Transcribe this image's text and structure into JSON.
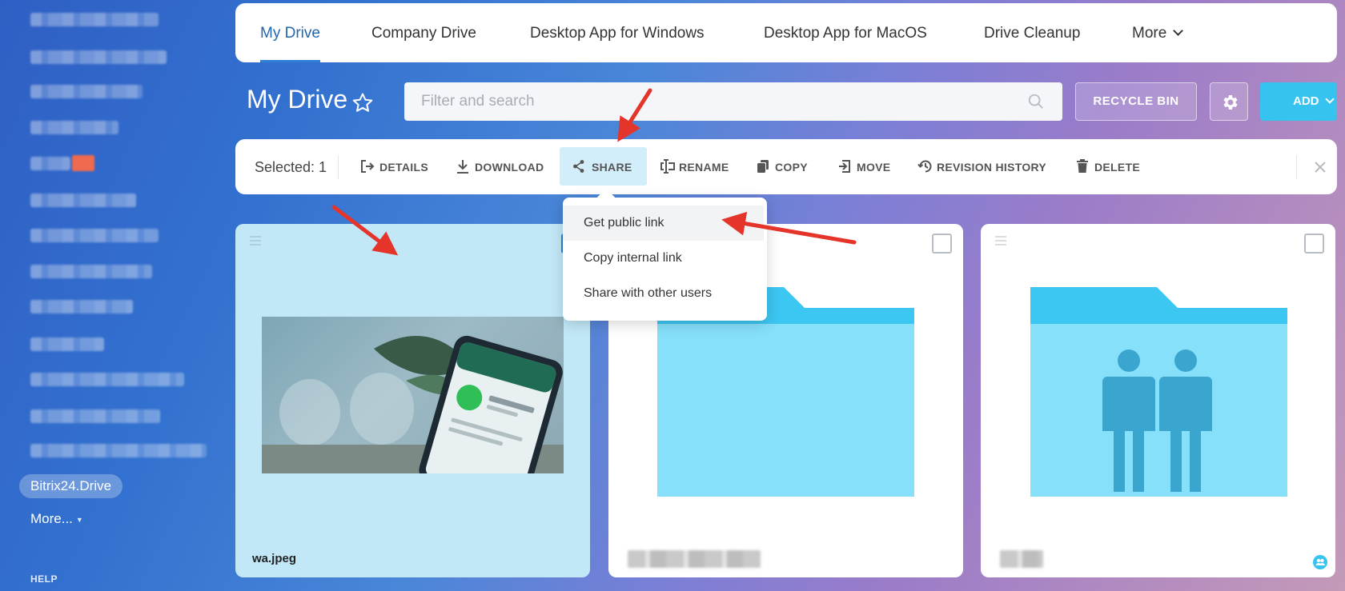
{
  "sidebar": {
    "active_item": "Bitrix24.Drive",
    "more_label": "More...",
    "help_label": "HELP"
  },
  "tabs": [
    {
      "label": "My Drive",
      "active": true
    },
    {
      "label": "Company Drive"
    },
    {
      "label": "Desktop App for Windows"
    },
    {
      "label": "Desktop App for MacOS"
    },
    {
      "label": "Drive Cleanup"
    },
    {
      "label": "More"
    }
  ],
  "header": {
    "title": "My Drive",
    "search_placeholder": "Filter and search",
    "recycle_label": "RECYCLE BIN",
    "add_label": "ADD"
  },
  "actionbar": {
    "selected_label": "Selected: 1",
    "actions": {
      "details": "DETAILS",
      "download": "DOWNLOAD",
      "share": "SHARE",
      "rename": "RENAME",
      "copy": "COPY",
      "move": "MOVE",
      "revision_history": "REVISION HISTORY",
      "delete": "DELETE"
    }
  },
  "share_menu": {
    "items": [
      "Get public link",
      "Copy internal link",
      "Share with other users"
    ]
  },
  "files": [
    {
      "name": "wa.jpeg",
      "type": "image",
      "selected": true
    },
    {
      "name": "",
      "type": "folder",
      "selected": false
    },
    {
      "name": "",
      "type": "shared-folder",
      "selected": false
    }
  ],
  "colors": {
    "accent": "#2f7fd6",
    "add_button": "#36c3f0",
    "annotation_arrow": "#e5352b",
    "folder": "#36c3f0"
  }
}
